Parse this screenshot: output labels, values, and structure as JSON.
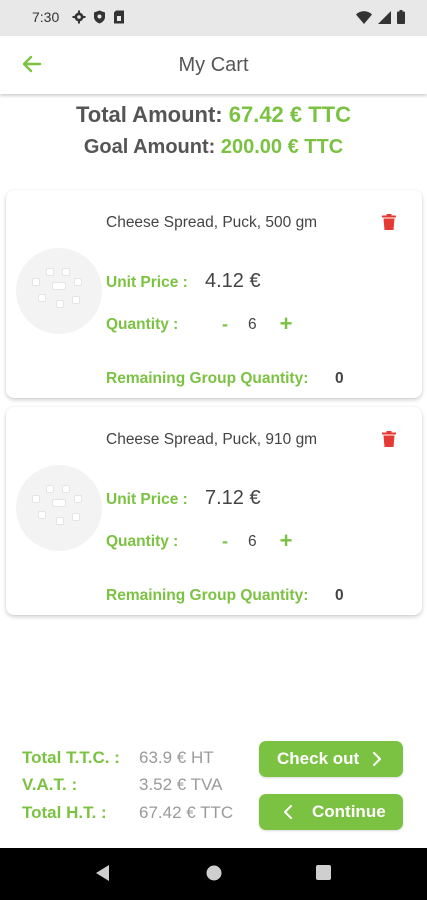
{
  "status_bar": {
    "time": "7:30",
    "left_icons": [
      "gear-icon",
      "shield-icon",
      "sim-card-icon"
    ],
    "right_icons": [
      "wifi-icon",
      "signal-icon",
      "battery-icon"
    ]
  },
  "app_bar": {
    "back_icon": "arrow-left-icon",
    "title": "My Cart"
  },
  "totals": {
    "total_label": "Total Amount:",
    "total_value": "67.42 € TTC",
    "goal_label": "Goal Amount:",
    "goal_value": "200.00 € TTC"
  },
  "cart_items": [
    {
      "name": "Cheese Spread, Puck, 500 gm",
      "unit_price_label": "Unit Price :",
      "unit_price": "4.12 €",
      "quantity_label": "Quantity :",
      "minus": "-",
      "quantity": "6",
      "plus": "+",
      "remaining_label": "Remaining Group Quantity:",
      "remaining_value": "0"
    },
    {
      "name": "Cheese Spread, Puck, 910 gm",
      "unit_price_label": "Unit Price :",
      "unit_price": "7.12 €",
      "quantity_label": "Quantity :",
      "minus": "-",
      "quantity": "6",
      "plus": "+",
      "remaining_label": "Remaining Group Quantity:",
      "remaining_value": "0"
    }
  ],
  "summary": {
    "ttc_label": "Total T.T.C. :",
    "ttc_value": "63.9 € HT",
    "vat_label": "V.A.T. :",
    "vat_value": "3.52 € TVA",
    "ht_label": "Total H.T. :",
    "ht_value": "67.42 € TTC"
  },
  "buttons": {
    "checkout": "Check out",
    "continue": "Continue"
  },
  "colors": {
    "accent": "#7cc242",
    "delete": "#e53935",
    "text": "#444444",
    "muted": "#9a9a9a"
  }
}
